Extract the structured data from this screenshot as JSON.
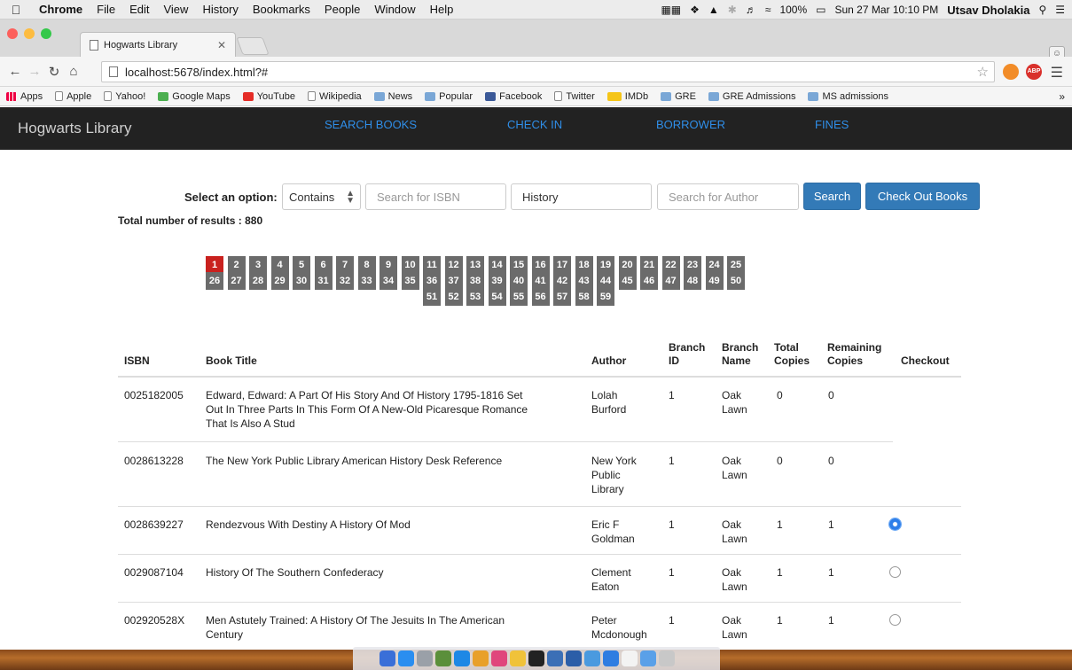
{
  "menubar": {
    "app": "Chrome",
    "items": [
      "File",
      "Edit",
      "View",
      "History",
      "Bookmarks",
      "People",
      "Window",
      "Help"
    ],
    "battery": "100%",
    "datetime": "Sun 27 Mar 10:10 PM",
    "user": "Utsav Dholakia"
  },
  "browser": {
    "tab_title": "Hogwarts Library",
    "url": "localhost:5678/index.html?#",
    "bookmarks": [
      {
        "label": "Apps",
        "icon": "apps-icon"
      },
      {
        "label": "Apple",
        "icon": "doc-icon"
      },
      {
        "label": "Yahoo!",
        "icon": "doc-icon"
      },
      {
        "label": "Google Maps",
        "icon": "maps-icon"
      },
      {
        "label": "YouTube",
        "icon": "yt-icon"
      },
      {
        "label": "Wikipedia",
        "icon": "doc-icon"
      },
      {
        "label": "News",
        "icon": "folder-icon"
      },
      {
        "label": "Popular",
        "icon": "folder-icon"
      },
      {
        "label": "Facebook",
        "icon": "fb-icon"
      },
      {
        "label": "Twitter",
        "icon": "doc-icon"
      },
      {
        "label": "IMDb",
        "icon": "imdb-icon"
      },
      {
        "label": "GRE",
        "icon": "folder-icon"
      },
      {
        "label": "GRE Admissions",
        "icon": "folder-icon"
      },
      {
        "label": "MS admissions",
        "icon": "folder-icon"
      }
    ],
    "bookmarks_more": "»",
    "extensions": {
      "abp": "ABP"
    }
  },
  "nav": {
    "brand": "Hogwarts Library",
    "links": [
      "SEARCH BOOKS",
      "CHECK IN",
      "BORROWER",
      "FINES"
    ]
  },
  "search": {
    "label": "Select an option:",
    "option_selected": "Contains",
    "isbn_placeholder": "Search for ISBN",
    "title_value": "History",
    "author_placeholder": "Search for Author",
    "search_label": "Search",
    "checkout_label": "Check Out Books"
  },
  "results": {
    "total_text": "Total number of results : 880",
    "current_page": "1",
    "pages": [
      "1",
      "2",
      "3",
      "4",
      "5",
      "6",
      "7",
      "8",
      "9",
      "10",
      "11",
      "12",
      "13",
      "14",
      "15",
      "16",
      "17",
      "18",
      "19",
      "20",
      "21",
      "22",
      "23",
      "24",
      "25",
      "26",
      "27",
      "28",
      "29",
      "30",
      "31",
      "32",
      "33",
      "34",
      "35",
      "36",
      "37",
      "38",
      "39",
      "40",
      "41",
      "42",
      "43",
      "44",
      "45",
      "46",
      "47",
      "48",
      "49",
      "50",
      "51",
      "52",
      "53",
      "54",
      "55",
      "56",
      "57",
      "58",
      "59"
    ]
  },
  "table": {
    "headers": {
      "isbn": "ISBN",
      "title": "Book Title",
      "author": "Author",
      "branch_id": [
        "Branch",
        "ID"
      ],
      "branch_name": [
        "Branch",
        "Name"
      ],
      "total": [
        "Total",
        "Copies"
      ],
      "remaining": [
        "Remaining",
        "Copies"
      ],
      "checkout": "Checkout"
    },
    "rows": [
      {
        "isbn": "0025182005",
        "title": [
          "Edward, Edward: A Part Of His Story And Of History 1795-1816 Set",
          "Out In Three Parts In This Form Of A New-Old Picaresque Romance",
          "That Is Also A Stud"
        ],
        "author": [
          "Lolah",
          "Burford"
        ],
        "branch_id": "1",
        "branch_name": [
          "Oak",
          "Lawn"
        ],
        "total": "0",
        "remaining": "0",
        "checkout": "none"
      },
      {
        "isbn": "0028613228",
        "title": [
          "The New York Public Library American History Desk Reference"
        ],
        "author": [
          "New York",
          "Public",
          "Library"
        ],
        "branch_id": "1",
        "branch_name": [
          "Oak",
          "Lawn"
        ],
        "total": "0",
        "remaining": "0",
        "checkout": "none"
      },
      {
        "isbn": "0028639227",
        "title": [
          "Rendezvous With Destiny A History Of Mod"
        ],
        "author": [
          "Eric F",
          "Goldman"
        ],
        "branch_id": "1",
        "branch_name": [
          "Oak",
          "Lawn"
        ],
        "total": "1",
        "remaining": "1",
        "checkout": "checked"
      },
      {
        "isbn": "0029087104",
        "title": [
          "History Of The Southern Confederacy"
        ],
        "author": [
          "Clement",
          "Eaton"
        ],
        "branch_id": "1",
        "branch_name": [
          "Oak",
          "Lawn"
        ],
        "total": "1",
        "remaining": "1",
        "checkout": "unchecked"
      },
      {
        "isbn": "002920528X",
        "title": [
          "Men Astutely Trained: A History Of The Jesuits In The American",
          "Century"
        ],
        "author": [
          "Peter",
          "Mcdonough"
        ],
        "branch_id": "1",
        "branch_name": [
          "Oak",
          "Lawn"
        ],
        "total": "1",
        "remaining": "1",
        "checkout": "unchecked"
      }
    ]
  },
  "colors": {
    "navbar_bg": "#222222",
    "nav_link": "#2f8ee8",
    "primary_button": "#337ab7",
    "page_active": "#c9211e",
    "page_default": "#6b6b6b"
  }
}
